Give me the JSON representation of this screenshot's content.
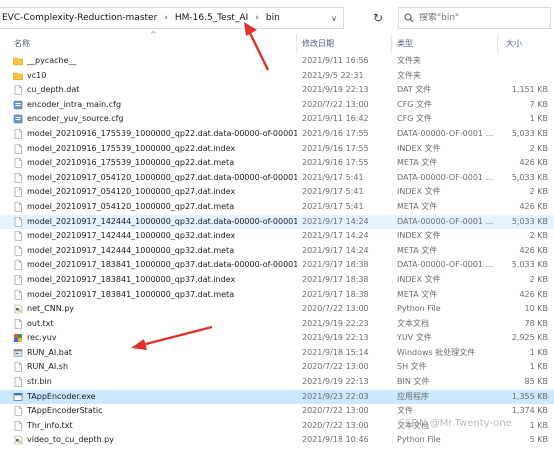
{
  "address_bar": {
    "crumbs": [
      "EVC-Complexity-Reduction-master",
      "HM-16.5_Test_AI",
      "bin"
    ],
    "separator": "›",
    "dropdown_glyph": "∨"
  },
  "refresh_glyph": "↻",
  "search": {
    "placeholder": "搜索\"bin\""
  },
  "columns": {
    "name": "名称",
    "date": "修改日期",
    "type": "类型",
    "size": "大小",
    "sort_glyph": "^"
  },
  "rows": [
    {
      "icon": "folder",
      "name": "__pycache__",
      "date": "2021/9/11 16:56",
      "type": "文件夹",
      "size": ""
    },
    {
      "icon": "folder",
      "name": "vc10",
      "date": "2021/9/5 22:31",
      "type": "文件夹",
      "size": ""
    },
    {
      "icon": "file",
      "name": "cu_depth.dat",
      "date": "2021/9/19 22:13",
      "type": "DAT 文件",
      "size": "1,151 KB"
    },
    {
      "icon": "cfg",
      "name": "encoder_intra_main.cfg",
      "date": "2020/7/22 13:00",
      "type": "CFG 文件",
      "size": "7 KB"
    },
    {
      "icon": "cfg",
      "name": "encoder_yuv_source.cfg",
      "date": "2021/9/11 16:42",
      "type": "CFG 文件",
      "size": "1 KB"
    },
    {
      "icon": "file",
      "name": "model_20210916_175539_1000000_qp22.dat.data-00000-of-00001",
      "date": "2021/9/16 17:55",
      "type": "DATA-00000-OF-0001 ...",
      "size": "5,033 KB"
    },
    {
      "icon": "file",
      "name": "model_20210916_175539_1000000_qp22.dat.index",
      "date": "2021/9/16 17:55",
      "type": "INDEX 文件",
      "size": "2 KB"
    },
    {
      "icon": "file",
      "name": "model_20210916_175539_1000000_qp22.dat.meta",
      "date": "2021/9/16 17:55",
      "type": "META 文件",
      "size": "426 KB"
    },
    {
      "icon": "file",
      "name": "model_20210917_054120_1000000_qp27.dat.data-00000-of-00001",
      "date": "2021/9/17 5:41",
      "type": "DATA-00000-OF-0001 ...",
      "size": "5,033 KB"
    },
    {
      "icon": "file",
      "name": "model_20210917_054120_1000000_qp27.dat.index",
      "date": "2021/9/17 5:41",
      "type": "INDEX 文件",
      "size": "2 KB"
    },
    {
      "icon": "file",
      "name": "model_20210917_054120_1000000_qp27.dat.meta",
      "date": "2021/9/17 5:41",
      "type": "META 文件",
      "size": "426 KB"
    },
    {
      "icon": "file",
      "name": "model_20210917_142444_1000000_qp32.dat.data-00000-of-00001",
      "date": "2021/9/17 14:24",
      "type": "DATA-00000-OF-0001 ...",
      "size": "5,033 KB",
      "state": "hl"
    },
    {
      "icon": "file",
      "name": "model_20210917_142444_1000000_qp32.dat.index",
      "date": "2021/9/17 14:24",
      "type": "INDEX 文件",
      "size": "2 KB"
    },
    {
      "icon": "file",
      "name": "model_20210917_142444_1000000_qp32.dat.meta",
      "date": "2021/9/17 14:24",
      "type": "META 文件",
      "size": "426 KB"
    },
    {
      "icon": "file",
      "name": "model_20210917_183841_1000000_qp37.dat.data-00000-of-00001",
      "date": "2021/9/17 18:38",
      "type": "DATA-00000-OF-0001 ...",
      "size": "5,033 KB"
    },
    {
      "icon": "file",
      "name": "model_20210917_183841_1000000_qp37.dat.index",
      "date": "2021/9/17 18:38",
      "type": "INDEX 文件",
      "size": "2 KB"
    },
    {
      "icon": "file",
      "name": "model_20210917_183841_1000000_qp37.dat.meta",
      "date": "2021/9/17 18:38",
      "type": "META 文件",
      "size": "426 KB"
    },
    {
      "icon": "py",
      "name": "net_CNN.py",
      "date": "2020/7/22 13:00",
      "type": "Python File",
      "size": "10 KB"
    },
    {
      "icon": "file",
      "name": "out.txt",
      "date": "2021/9/19 22:23",
      "type": "文本文档",
      "size": "78 KB"
    },
    {
      "icon": "yuv",
      "name": "rec.yuv",
      "date": "2021/9/19 22:13",
      "type": "YUV 文件",
      "size": "2,925 KB"
    },
    {
      "icon": "bat",
      "name": "RUN_AI.bat",
      "date": "2021/9/18 15:14",
      "type": "Windows 批处理文件",
      "size": "1 KB"
    },
    {
      "icon": "file",
      "name": "RUN_AI.sh",
      "date": "2020/7/22 13:00",
      "type": "SH 文件",
      "size": "1 KB"
    },
    {
      "icon": "file",
      "name": "str.bin",
      "date": "2021/9/19 22:13",
      "type": "BIN 文件",
      "size": "85 KB"
    },
    {
      "icon": "exe",
      "name": "TAppEncoder.exe",
      "date": "2021/9/23 22:03",
      "type": "应用程序",
      "size": "1,355 KB",
      "state": "sel"
    },
    {
      "icon": "file",
      "name": "TAppEncoderStatic",
      "date": "2020/7/22 13:00",
      "type": "文件",
      "size": "1,374 KB"
    },
    {
      "icon": "file",
      "name": "Thr_info.txt",
      "date": "2020/7/22 13:00",
      "type": "文本文档",
      "size": "1 KB"
    },
    {
      "icon": "py",
      "name": "video_to_cu_depth.py",
      "date": "2021/9/18 10:46",
      "type": "Python File",
      "size": "5 KB"
    }
  ],
  "watermark": "CSDN @Mr.Twenty-one",
  "colors": {
    "arrow": "#e1312b",
    "selected_row": "#cce8ff",
    "hover_row": "#e5f3ff",
    "folder": "#f6c344"
  }
}
